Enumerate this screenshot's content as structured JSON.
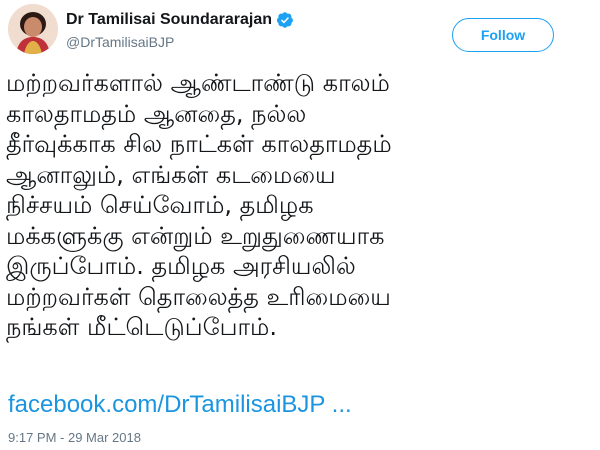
{
  "author": {
    "display_name": "Dr Tamilisai Soundararajan",
    "handle": "@DrTamilisaiBJP",
    "verified": true
  },
  "follow_button": {
    "label": "Follow"
  },
  "tweet": {
    "lines": [
      "மற்றவர்களால் ஆண்டாண்டு காலம்",
      "காலதாமதம் ஆனதை, நல்ல",
      "தீர்வுக்காக சில நாட்கள் காலதாமதம்",
      "ஆனாலும், எங்கள் கடமையை",
      "நிச்சயம் செய்வோம், தமிழக",
      "மக்களுக்கு என்றும் உறுதுணையாக",
      "இருப்போம். தமிழக அரசியலில்",
      "மற்றவர்கள் தொலைத்த உரிமையை",
      "நங்கள் மீட்டெடுப்போம்."
    ],
    "link": "facebook.com/DrTamilisaiBJP ...",
    "timestamp": "9:17 PM - 29 Mar 2018"
  },
  "colors": {
    "accent": "#1da1f2",
    "link": "#1b95e0",
    "secondary_text": "#657786",
    "primary_text": "#14171a"
  },
  "icons": {
    "verified": "verified-badge-icon",
    "avatar": "profile-photo"
  }
}
